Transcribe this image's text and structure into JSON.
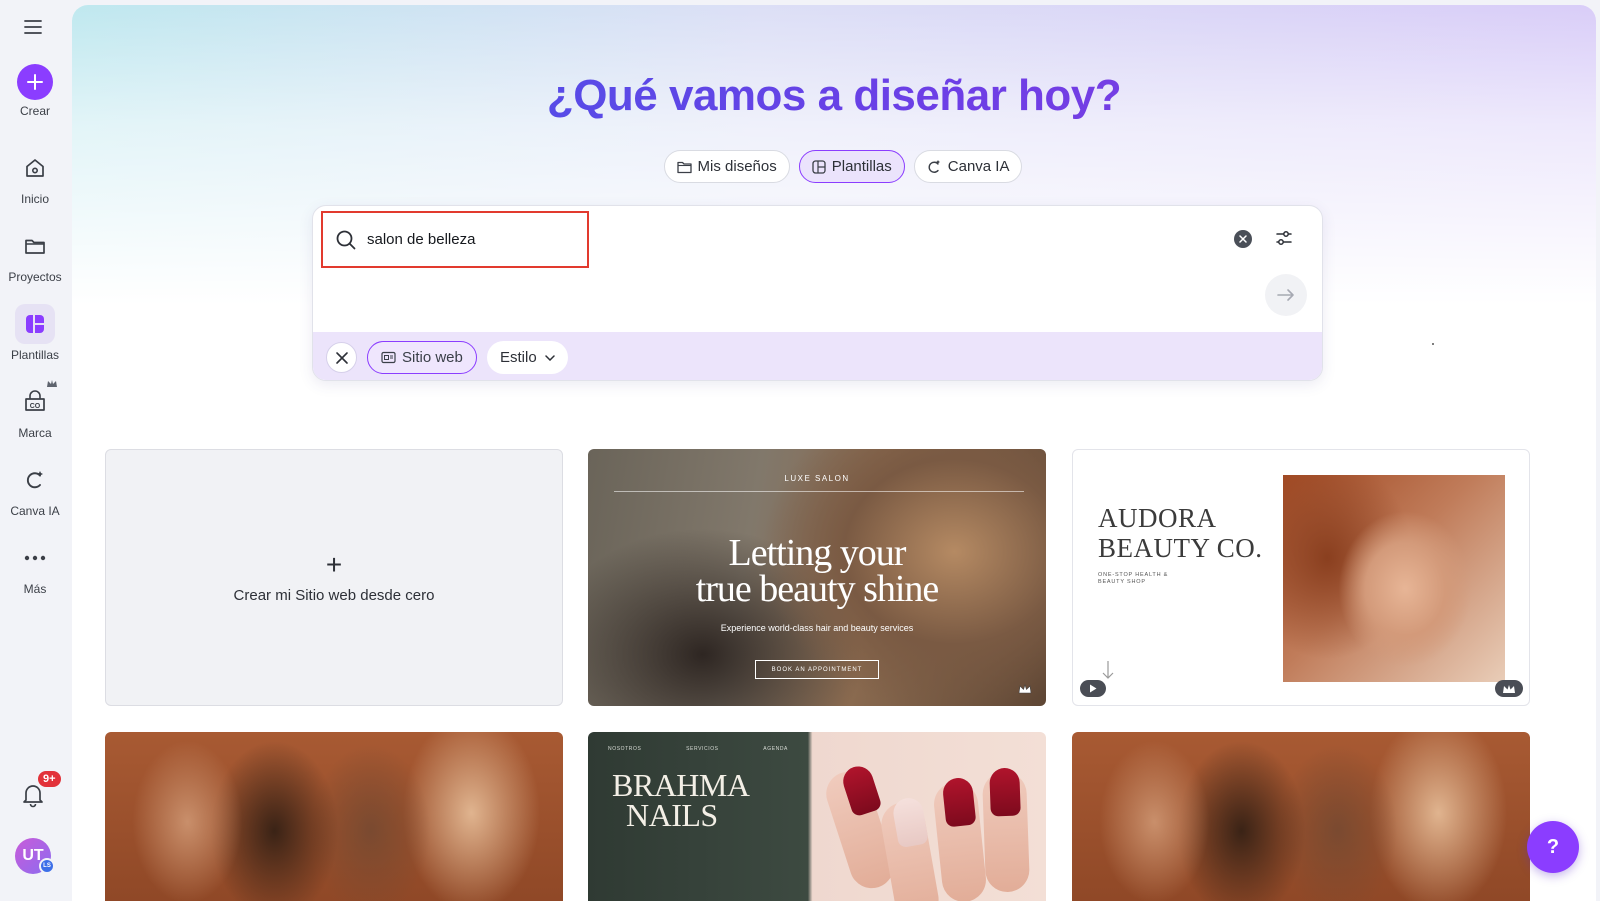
{
  "sidebar": {
    "items": [
      {
        "label": "Crear"
      },
      {
        "label": "Inicio"
      },
      {
        "label": "Proyectos"
      },
      {
        "label": "Plantillas"
      },
      {
        "label": "Marca"
      },
      {
        "label": "Canva IA"
      },
      {
        "label": "Más"
      }
    ],
    "notification_count": "9+",
    "avatar_initials": "UT",
    "avatar_team": "LS"
  },
  "hero": {
    "title": "¿Qué vamos a diseñar hoy?",
    "tabs": [
      {
        "label": "Mis diseños",
        "icon": "folder-icon"
      },
      {
        "label": "Plantillas",
        "icon": "template-icon",
        "active": true
      },
      {
        "label": "Canva IA",
        "icon": "canva-ai-icon"
      }
    ]
  },
  "search": {
    "query": "salon de belleza",
    "chips": {
      "type_label": "Sitio web",
      "style_label": "Estilo"
    }
  },
  "templates": {
    "blank": {
      "plus": "+",
      "label": "Crear mi Sitio web desde cero"
    },
    "luxe": {
      "brand": "LUXE SALON",
      "title_line1": "Letting your",
      "title_line2": "true beauty shine",
      "subtitle": "Experience world-class hair and beauty services",
      "cta": "BOOK AN APPOINTMENT"
    },
    "audora": {
      "title_line1": "AUDORA",
      "title_line2": "BEAUTY CO.",
      "subtitle": "ONE-STOP HEALTH & BEAUTY SHOP"
    },
    "nails": {
      "nav": [
        "NOSOTROS",
        "SERVICIOS",
        "AGENDA"
      ],
      "title_line1": "BRAHMA",
      "title_line2": "NAILS"
    }
  },
  "help": {
    "label": "?"
  },
  "colors": {
    "accent": "#8b3dff",
    "highlight_border": "#e23a2e"
  }
}
